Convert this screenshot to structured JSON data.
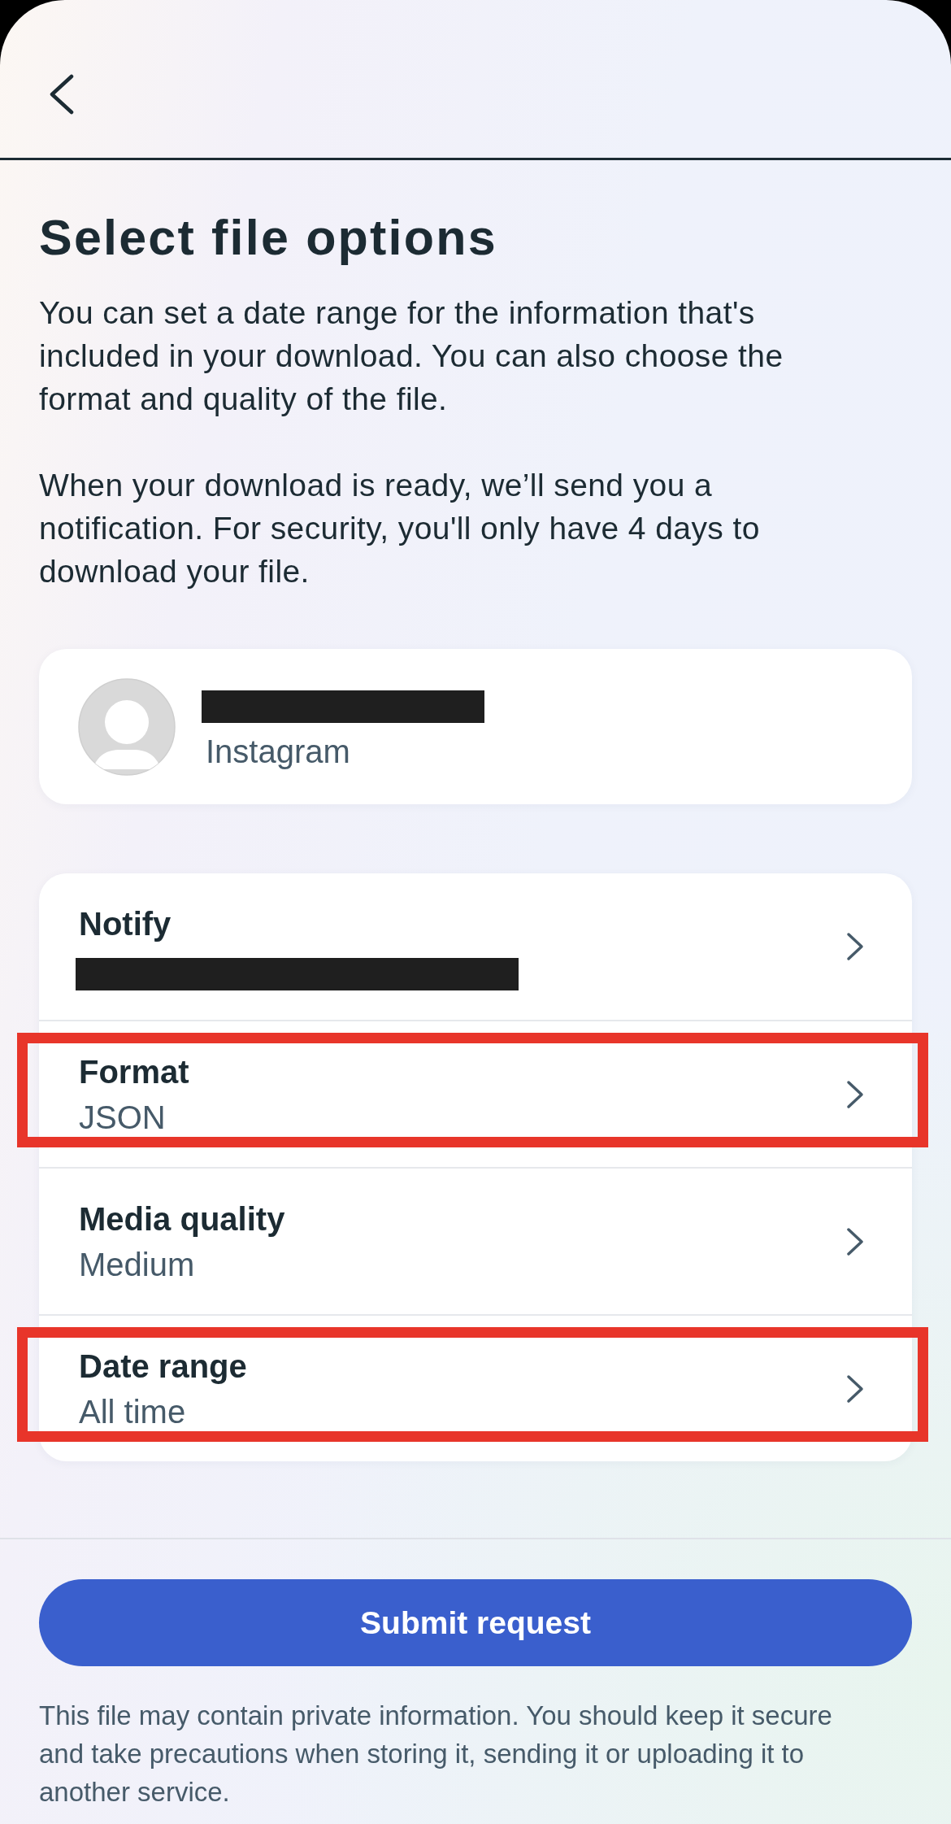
{
  "title": "Select file options",
  "description": [
    "You can set a date range for the information that's included in your download. You can also choose the format and quality of the file.",
    "When your download is ready, we’ll send you a notification. For security, you'll only have 4 days to download your file."
  ],
  "account": {
    "redacted": true,
    "platform": "Instagram"
  },
  "options": [
    {
      "label": "Notify",
      "redacted": true,
      "highlighted": false
    },
    {
      "label": "Format",
      "value": "JSON",
      "redacted": false,
      "highlighted": true
    },
    {
      "label": "Media quality",
      "value": "Medium",
      "redacted": false,
      "highlighted": false
    },
    {
      "label": "Date range",
      "value": "All time",
      "redacted": false,
      "highlighted": true
    }
  ],
  "submit_button": "Submit request",
  "disclaimer": "This file may contain private information. You should keep it secure and take precautions when storing it, sending it or uploading it to another service."
}
